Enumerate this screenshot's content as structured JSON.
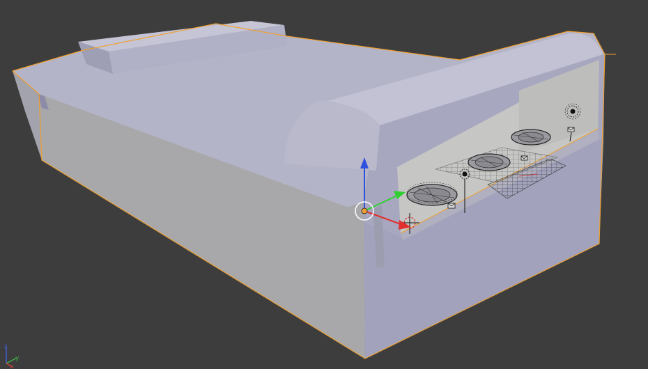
{
  "viewport": {
    "background": "#3d3d3d",
    "object_color": "#b8b8cc",
    "selection_outline": "#f0a030"
  },
  "mini_axis": {
    "x_label": "x",
    "y_label": "y",
    "z_label": "z",
    "x_color": "#d04040",
    "y_color": "#40b040",
    "z_color": "#4060d0"
  },
  "manipulator": {
    "x_color": "#e03030",
    "y_color": "#30d030",
    "z_color": "#3050e0"
  },
  "scene_objects": {
    "fans": 3,
    "lamps": 3,
    "grids": 2
  }
}
